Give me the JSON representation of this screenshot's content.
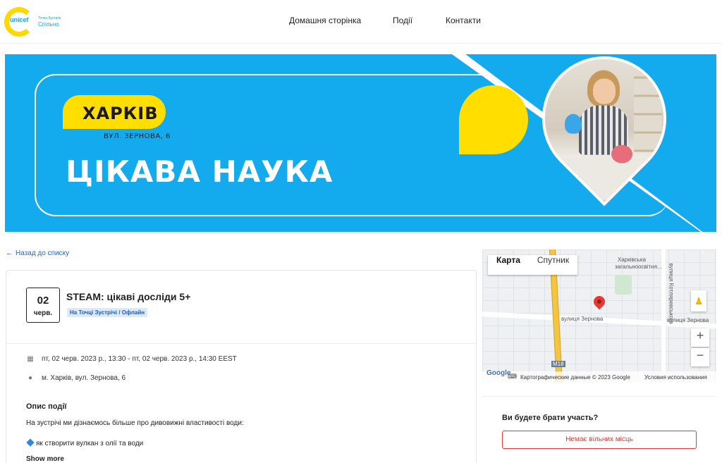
{
  "logo": {
    "brand": "unicef",
    "subtitle_small": "Точка Зустрічі",
    "subtitle": "Спільно"
  },
  "nav": {
    "items": [
      {
        "label": "Домашня сторінка"
      },
      {
        "label": "Події"
      },
      {
        "label": "Контакти"
      }
    ]
  },
  "banner": {
    "city": "ХАРКІВ",
    "street": "ВУЛ. ЗЕРНОВА, 6",
    "title": "ЦІКАВА НАУКА"
  },
  "back_link": "Назад до списку",
  "event": {
    "date_day": "02",
    "date_month": "черв.",
    "title": "STEAM: цікаві досліди 5+",
    "tag": "На Точці Зустрічі / Офлайн",
    "datetime": "пт, 02 черв. 2023 р., 13:30 - пт, 02 черв. 2023 р., 14:30 EEST",
    "location": "м. Харків, вул. Зернова, 6",
    "description_title": "Опис події",
    "description": "На зустрічі ми дізнаємось більше про дивовижні властивості води:",
    "bullet": "як створити вулкан з олії та води",
    "show_more": "Show more"
  },
  "map": {
    "tab_map": "Карта",
    "tab_satellite": "Спутник",
    "label_school_1": "Харківська",
    "label_school_2": "загальноосвітня...",
    "label_street_1": "вулиця Зернова",
    "label_street_2": "вулиця Зернова",
    "label_street_vertical": "вулиця Котляревського",
    "label_road": "M18",
    "google": "Google",
    "copyright": "Картографические данные © 2023 Google",
    "terms": "Условия использования",
    "zoom_in": "+",
    "zoom_out": "−"
  },
  "participation": {
    "question": "Ви будете брати участь?",
    "button": "Немає вільних місць"
  },
  "colors": {
    "banner_blue": "#14aaee",
    "accent_yellow": "#ffde00",
    "link_blue": "#1769d6",
    "danger_red": "#e53935"
  }
}
